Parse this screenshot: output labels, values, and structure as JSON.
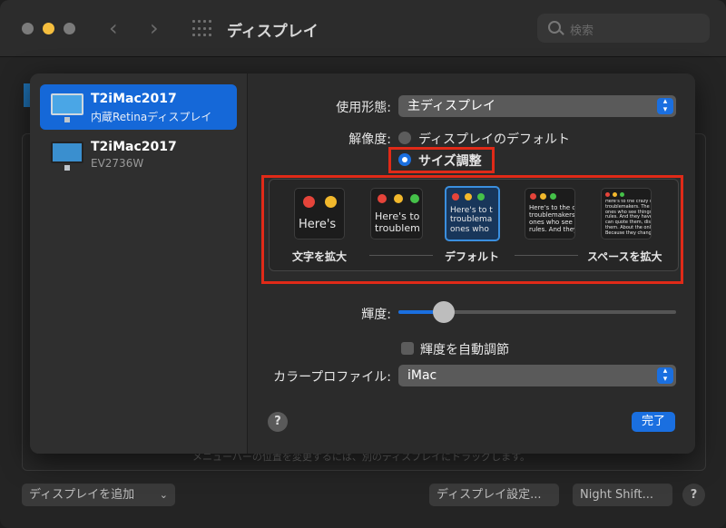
{
  "window": {
    "title": "ディスプレイ",
    "search_placeholder": "検索"
  },
  "background": {
    "hint": "メニューバーの位置を変更するには、別のディスプレイにドラッグします。",
    "add_display": "ディスプレイを追加",
    "display_settings": "ディスプレイ設定...",
    "night_shift": "Night Shift...",
    "help": "?"
  },
  "displays": [
    {
      "name": "T2iMac2017",
      "subtitle": "内蔵Retinaディスプレイ",
      "selected": true
    },
    {
      "name": "T2iMac2017",
      "subtitle": "EV2736W",
      "selected": false
    }
  ],
  "settings": {
    "use_as_label": "使用形態:",
    "use_as_value": "主ディスプレイ",
    "resolution_label": "解像度:",
    "resolution_default": "ディスプレイのデフォルト",
    "resolution_scaled": "サイズ調整",
    "resolution_selected": "サイズ調整",
    "scaled_options": [
      {
        "text": "Here's",
        "selected": false
      },
      {
        "text": "Here's to\ntroublem",
        "selected": false
      },
      {
        "text": "Here's to t\ntroublema\nones who",
        "selected": true
      },
      {
        "text": "Here's to the cr\ntroublemakers. T\nones who see t\nrules. And they",
        "selected": false
      },
      {
        "text": "Here's to the crazy one\ntroublemakers. The rou\nones who see things dif\nrules. And they have no\ncan quote them, disagre\nthem. About the only th\nBecause they change t",
        "selected": false
      }
    ],
    "scale_labels": {
      "larger": "文字を拡大",
      "default": "デフォルト",
      "more_space": "スペースを拡大"
    },
    "brightness_label": "輝度:",
    "brightness_level": 0.15,
    "auto_brightness_label": "輝度を自動調節",
    "auto_brightness_checked": false,
    "color_profile_label": "カラープロファイル:",
    "color_profile_value": "iMac",
    "help": "?",
    "done": "完了"
  },
  "colors": {
    "accent": "#1a6fe0",
    "highlight_box": "#e02a18",
    "selected_row": "#1568d8"
  }
}
